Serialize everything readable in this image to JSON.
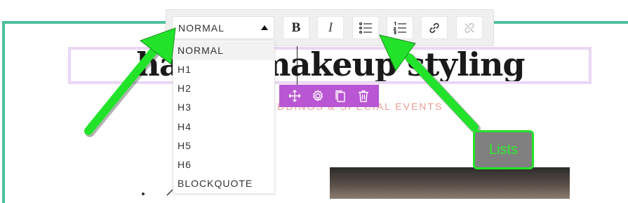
{
  "heading": {
    "text": "hair & makeup styling"
  },
  "subtitle": {
    "text": "WEDDINGS & SPECIAL EVENTS"
  },
  "format_toolbar": {
    "block_type_select": {
      "value": "NORMAL"
    },
    "buttons": {
      "bold": {
        "label": "B"
      },
      "italic": {
        "label": "I"
      },
      "bullet_list": {
        "icon": "bullet-list-icon"
      },
      "numbered_list": {
        "icon": "numbered-list-icon"
      },
      "link": {
        "icon": "link-icon"
      },
      "unlink": {
        "icon": "unlink-icon",
        "state": "disabled"
      }
    }
  },
  "block_type_dropdown": {
    "options": [
      "NORMAL",
      "H1",
      "H2",
      "H3",
      "H4",
      "H5",
      "H6",
      "BLOCKQUOTE"
    ],
    "highlighted": "NORMAL"
  },
  "block_toolbar": {
    "icons": [
      "move-icon",
      "settings-icon",
      "duplicate-icon",
      "delete-icon"
    ]
  },
  "annotation": {
    "callout_label": "Lists",
    "arrow_color": "#22e32a"
  },
  "colors": {
    "frame": "#4dbf9d",
    "block_toolbar": "#b956d3",
    "subtitle": "#ec9b91",
    "heading_outline": "#ead6f4",
    "callout_bg": "#808080"
  }
}
